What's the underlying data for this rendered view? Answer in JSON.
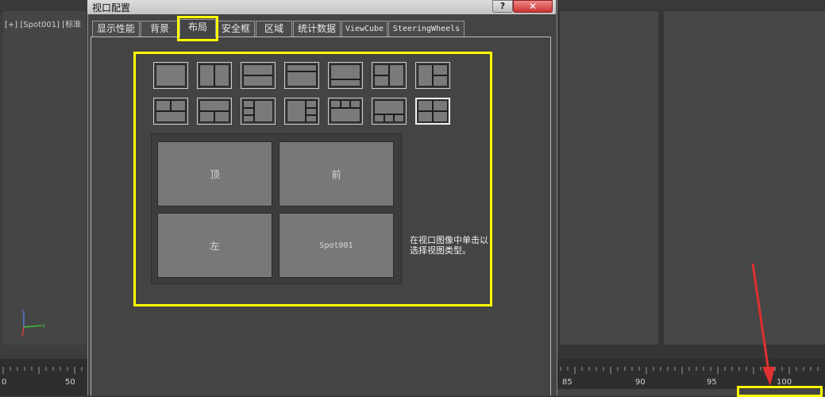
{
  "background": {
    "viewport_label": "[+] [Spot001] [标准",
    "timeline_ticks": [
      {
        "label": "0"
      },
      {
        "label": "50"
      },
      {
        "label": "85"
      },
      {
        "label": "90"
      },
      {
        "label": "95"
      },
      {
        "label": "100"
      }
    ]
  },
  "dialog": {
    "title": "视口配置",
    "help_label": "?",
    "close_label": "✕",
    "tabs": [
      {
        "label": "显示性能",
        "active": false
      },
      {
        "label": "背景",
        "active": false
      },
      {
        "label": "布局",
        "active": true
      },
      {
        "label": "安全框",
        "active": false
      },
      {
        "label": "区域",
        "active": false
      },
      {
        "label": "统计数据",
        "active": false
      },
      {
        "label": "ViewCube",
        "active": false
      },
      {
        "label": "SteeringWheels",
        "active": false
      }
    ],
    "layout": {
      "preview_views": [
        "顶",
        "前",
        "左",
        "Spot001"
      ],
      "hint": "在视口图像中单击以选择视图类型。"
    }
  },
  "colors": {
    "highlight": "#ffff00",
    "arrow": "#e03030"
  }
}
